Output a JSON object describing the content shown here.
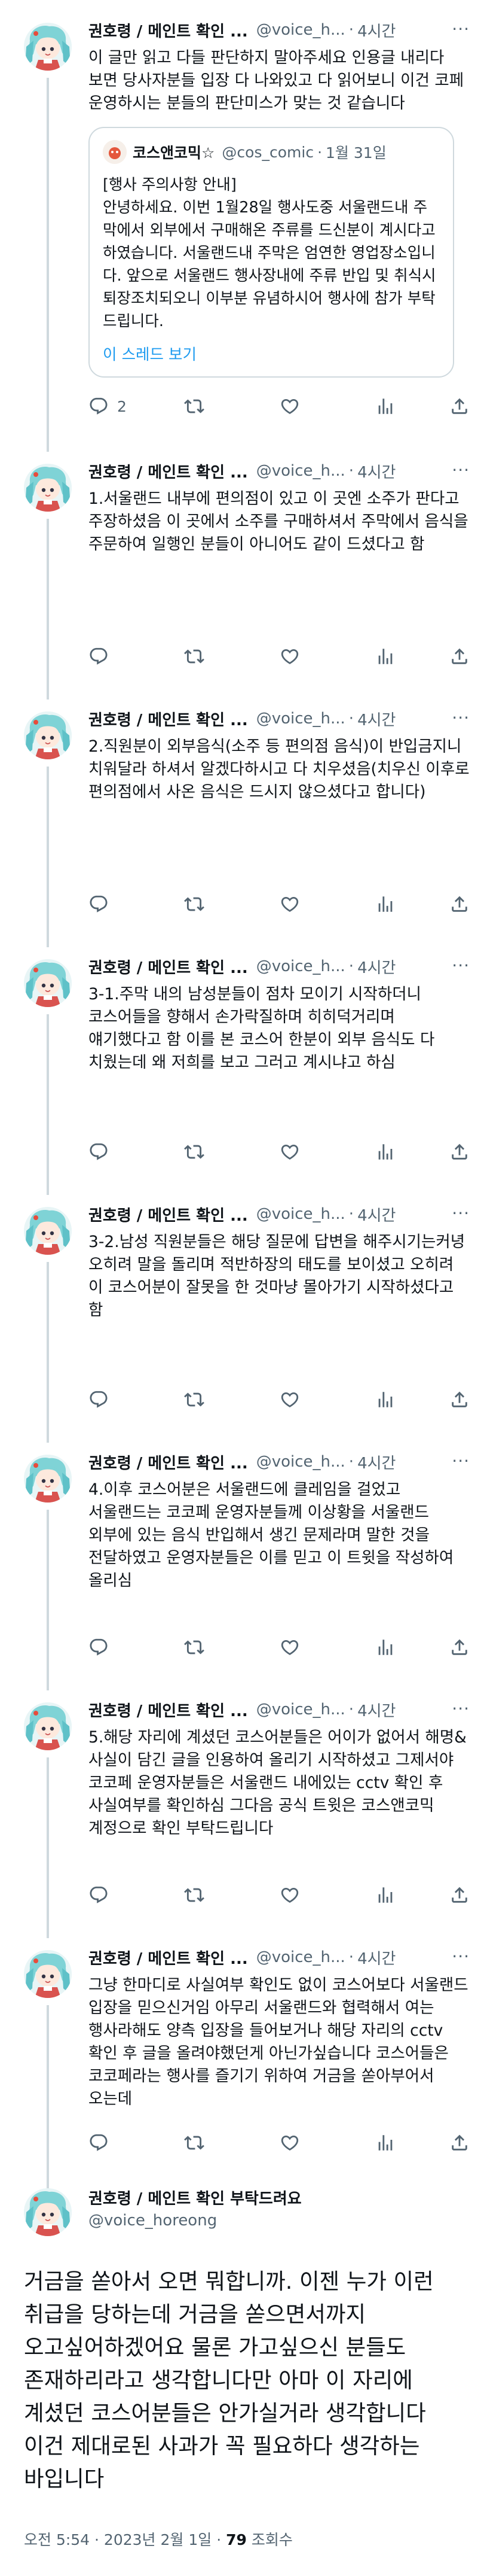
{
  "author": {
    "name": "권호령 / 메인트 확인 부탁드려요",
    "name_short": "권호령 / 메인트 확인 ...",
    "handle": "@voice_horeong",
    "handle_short": "@voice_h...",
    "time": "4시간",
    "more": "···"
  },
  "tweets": [
    {
      "text": "이 글만 읽고 다들 판단하지 말아주세요 인용글 내리다 보면 당사자분들 입장 다 나와있고 다 읽어보니 이건 코페 운영하시는 분들의 판단미스가 맞는 것 같습니다",
      "quote": {
        "name": "코스앤코믹☆",
        "handle": "@cos_comic",
        "date": "1월 31일",
        "lines": [
          "[행사 주의사항 안내]",
          "안녕하세요. 이번 1월28일 행사도중 서울랜드내 주막에서 외부에서 구매해온 주류를 드신분이 계시다고 하였습니다. 서울랜드내 주막은 엄연한 영업장소입니다. 앞으로 서울랜드 행사장내에 주류 반입 및 취식시 퇴장조치되오니 이부분 유념하시어 행사에 참가 부탁드립니다."
        ],
        "thread_link": "이 스레드 보기"
      },
      "reply_count": "2"
    },
    {
      "text": "1.서울랜드 내부에 편의점이 있고 이 곳엔 소주가 판다고 주장하셨음 이 곳에서 소주를 구매하셔서 주막에서 음식을 주문하여 일행인 분들이 아니어도 같이 드셨다고 함"
    },
    {
      "text": "2.직원분이 외부음식(소주 등 편의점 음식)이 반입금지니 치워달라 하셔서 알겠다하시고 다 치우셨음(치우신 이후로 편의점에서 사온 음식은 드시지 않으셨다고 합니다)"
    },
    {
      "text": "3-1.주막 내의 남성분들이 점차 모이기 시작하더니 코스어들을 향해서 손가락질하며 히히덕거리며 얘기했다고 함 이를 본 코스어 한분이 외부 음식도 다 치웠는데 왜 저희를 보고 그러고 계시냐고 하심"
    },
    {
      "text": "3-2.남성 직원분들은 해당 질문에 답변을 해주시기는커녕 오히려 말을 돌리며 적반하장의 태도를 보이셨고 오히려 이 코스어분이 잘못을 한 것마냥 몰아가기 시작하셨다고 함"
    },
    {
      "text": "4.이후 코스어분은 서울랜드에 클레임을 걸었고 서울랜드는 코코페 운영자분들께 이상황을 서울랜드 외부에 있는 음식 반입해서 생긴 문제라며 말한 것을 전달하였고 운영자분들은 이를 믿고 이 트윗을 작성하여 올리심"
    },
    {
      "text": "5.해당 자리에 계셨던 코스어분들은 어이가 없어서 해명&사실이 담긴 글을 인용하여 올리기 시작하셨고 그제서야 코코페 운영자분들은 서울랜드 내에있는 cctv 확인 후 사실여부를 확인하심 그다음 공식 트윗은 코스앤코믹 계정으로 확인 부탁드립니다"
    },
    {
      "text": "그냥 한마디로 사실여부 확인도 없이 코스어보다 서울랜드 입장을 믿으신거임 아무리 서울랜드와 협력해서 여는 행사라해도 양측 입장을 들어보거나 해당 자리의 cctv 확인 후 글을 올려야했던게 아닌가싶습니다 코스어들은 코코페라는 행사를 즐기기 위하여 거금을 쏟아부어서 오는데"
    }
  ],
  "main": {
    "text": "거금을 쏟아서 오면 뭐합니까. 이젠 누가 이런 취급을 당하는데 거금을 쏟으면서까지 오고싶어하겠어요 물론 가고싶으신 분들도 존재하리라고 생각합니다만 아마 이 자리에 계셨던 코스어분들은 안가실거라 생각합니다 이건 제대로된 사과가 꼭 필요하다 생각하는 바입니다",
    "timestamp": "오전 5:54 · 2023년 2월 1일 · ",
    "views_count": "79",
    "views_label": " 조회수"
  },
  "icons": {
    "reply": "reply-icon",
    "retweet": "retweet-icon",
    "like": "like-icon",
    "views": "views-icon",
    "share": "share-icon"
  },
  "colors": {
    "text": "#0f1419",
    "secondary": "#536471",
    "link": "#1d9bf0",
    "rail": "#cfd9de"
  }
}
